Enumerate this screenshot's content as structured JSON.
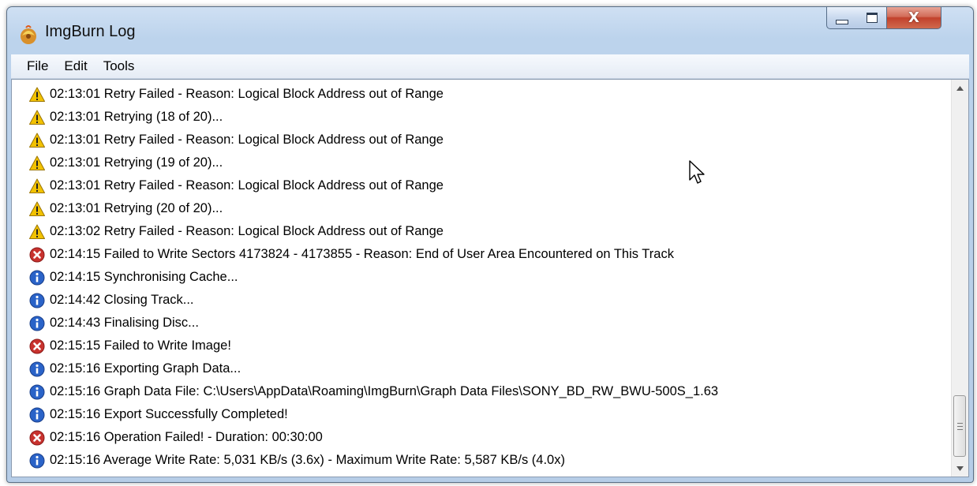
{
  "window": {
    "title": "ImgBurn Log",
    "close_glyph": "X"
  },
  "menu": [
    "File",
    "Edit",
    "Tools"
  ],
  "log": [
    {
      "type": "warning",
      "text": "02:13:01 Retry Failed - Reason: Logical Block Address out of Range"
    },
    {
      "type": "warning",
      "text": "02:13:01 Retrying (18 of 20)..."
    },
    {
      "type": "warning",
      "text": "02:13:01 Retry Failed - Reason: Logical Block Address out of Range"
    },
    {
      "type": "warning",
      "text": "02:13:01 Retrying (19 of 20)..."
    },
    {
      "type": "warning",
      "text": "02:13:01 Retry Failed - Reason: Logical Block Address out of Range"
    },
    {
      "type": "warning",
      "text": "02:13:01 Retrying (20 of 20)..."
    },
    {
      "type": "warning",
      "text": "02:13:02 Retry Failed - Reason: Logical Block Address out of Range"
    },
    {
      "type": "error",
      "text": "02:14:15 Failed to Write Sectors 4173824 - 4173855 - Reason: End of User Area Encountered on This Track"
    },
    {
      "type": "info",
      "text": "02:14:15 Synchronising Cache..."
    },
    {
      "type": "info",
      "text": "02:14:42 Closing Track..."
    },
    {
      "type": "info",
      "text": "02:14:43 Finalising Disc..."
    },
    {
      "type": "error",
      "text": "02:15:15 Failed to Write Image!"
    },
    {
      "type": "info",
      "text": "02:15:16 Exporting Graph Data..."
    },
    {
      "type": "info",
      "text": "02:15:16 Graph Data File: C:\\Users\\AppData\\Roaming\\ImgBurn\\Graph Data Files\\SONY_BD_RW_BWU-500S_1.63"
    },
    {
      "type": "info",
      "text": "02:15:16 Export Successfully Completed!"
    },
    {
      "type": "error",
      "text": "02:15:16 Operation Failed! - Duration: 00:30:00"
    },
    {
      "type": "info",
      "text": "02:15:16 Average Write Rate: 5,031 KB/s (3.6x) - Maximum Write Rate: 5,587 KB/s (4.0x)"
    }
  ],
  "icons": {
    "warning": "warning-icon",
    "error": "error-icon",
    "info": "info-icon"
  },
  "colors": {
    "warning": "#f2c200",
    "error": "#c8322e",
    "info": "#2a63c8"
  }
}
